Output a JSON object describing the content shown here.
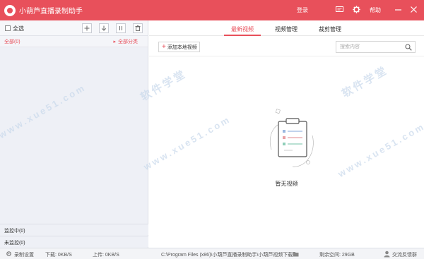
{
  "app": {
    "title": "小葫芦直播录制助手"
  },
  "titlebar": {
    "login": "登录",
    "help": "帮助"
  },
  "left": {
    "select_all": "全选",
    "categories": {
      "all": "全部(0)",
      "all_categories": "全部分类"
    },
    "monitoring": "监控中(0)",
    "not_monitoring": "未监控(0)"
  },
  "tabs": [
    {
      "label": "最新视频",
      "active": true
    },
    {
      "label": "视频管理",
      "active": false
    },
    {
      "label": "裁剪管理",
      "active": false
    }
  ],
  "toolbar": {
    "add_local": "添加本地视频"
  },
  "search": {
    "placeholder": "搜索内容"
  },
  "empty": {
    "text": "暂无视频"
  },
  "watermark": {
    "text": "软件学堂",
    "url": "www.xue51.com"
  },
  "status": {
    "settings": "录制设置",
    "download": "下载: 0KB/S",
    "upload": "上传: 0KB/S",
    "path": "C:\\Program Files (x86)\\小葫芦直播录制助手\\小葫芦视频下载",
    "free_space": "剩余空间: 29GB",
    "feedback": "交流反馈群"
  },
  "colors": {
    "accent": "#e8505b",
    "left_bg": "#eef0f6"
  }
}
